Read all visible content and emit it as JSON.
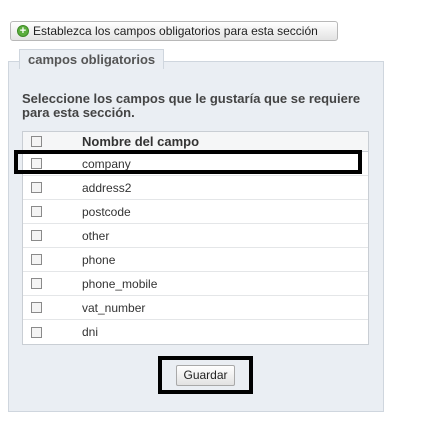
{
  "top_button": {
    "icon": "plus-circle-icon",
    "label": "Establezca los campos obligatorios para esta sección"
  },
  "panel": {
    "legend": "campos obligatorios",
    "instructions": "Seleccione los campos que le gustaría que se requiere para esta sección."
  },
  "table": {
    "header": "Nombre del campo",
    "rows": [
      "company",
      "address2",
      "postcode",
      "other",
      "phone",
      "phone_mobile",
      "vat_number",
      "dni"
    ]
  },
  "save_label": "Guardar",
  "colors": {
    "panel_bg": "#eaeef3",
    "icon_green": "#5cae3e",
    "highlight": "#000000"
  }
}
